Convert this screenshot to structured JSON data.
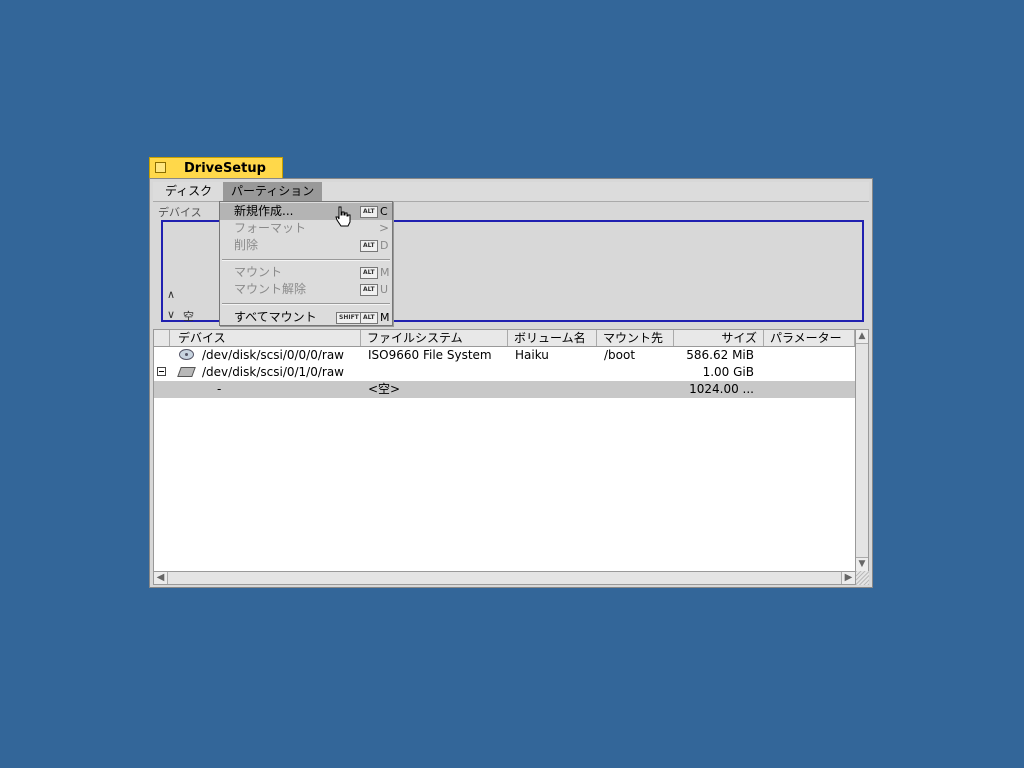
{
  "window": {
    "title": "DriveSetup"
  },
  "menubar": {
    "items": [
      {
        "label": "ディスク"
      },
      {
        "label": "パーティション"
      }
    ]
  },
  "disk_view": {
    "label": "デバイス",
    "empty_label": "空",
    "arrow_up": "∧",
    "arrow_down": "∨",
    "selection_color": "#2020b0"
  },
  "partition_menu": {
    "items": [
      {
        "label": "新規作成...",
        "shortcut_key": "ALT",
        "shortcut_letter": "C",
        "enabled": true,
        "highlighted": true
      },
      {
        "label": "フォーマット",
        "submenu_arrow": ">",
        "enabled": false
      },
      {
        "label": "削除",
        "shortcut_key": "ALT",
        "shortcut_letter": "D",
        "enabled": false
      },
      {
        "label": "マウント",
        "shortcut_key": "ALT",
        "shortcut_letter": "M",
        "enabled": false
      },
      {
        "label": "マウント解除",
        "shortcut_key": "ALT",
        "shortcut_letter": "U",
        "enabled": false
      },
      {
        "label": "すべてマウント",
        "shortcut_modifier": "SHIFT",
        "shortcut_key": "ALT",
        "shortcut_letter": "M",
        "enabled": true
      }
    ]
  },
  "table": {
    "columns": [
      "デバイス",
      "ファイルシステム",
      "ボリューム名",
      "マウント先",
      "サイズ",
      "パラメーター"
    ],
    "rows": [
      {
        "device": "/dev/disk/scsi/0/0/0/raw",
        "filesystem": "ISO9660 File System",
        "volume": "Haiku",
        "mount": "/boot",
        "size": "586.62 MiB",
        "params": "",
        "icon": "cd-icon"
      },
      {
        "device": "/dev/disk/scsi/0/1/0/raw",
        "filesystem": "",
        "volume": "",
        "mount": "",
        "size": "1.00 GiB",
        "params": "",
        "icon": "hard-disk-icon"
      },
      {
        "device": "-",
        "filesystem": "<空>",
        "volume": "",
        "mount": "",
        "size": "1024.00 ...",
        "params": "",
        "selected": true
      }
    ]
  },
  "colors": {
    "desktop": "#336699",
    "tab": "#ffd84a"
  }
}
